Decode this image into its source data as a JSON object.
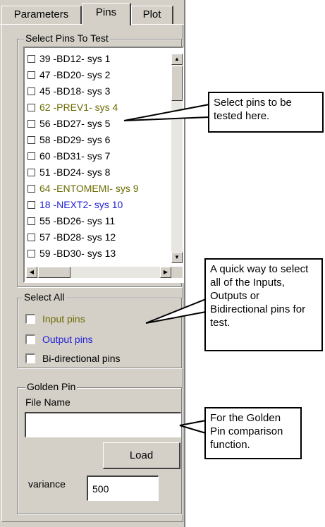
{
  "tabs": [
    {
      "label": "Parameters",
      "active": false
    },
    {
      "label": "Pins",
      "active": true
    },
    {
      "label": "Plot",
      "active": false
    }
  ],
  "select_pins": {
    "title": "Select Pins To Test",
    "items": [
      {
        "label": "39 -BD12- sys 1",
        "color": "#000000"
      },
      {
        "label": "47 -BD20- sys 2",
        "color": "#000000"
      },
      {
        "label": "45 -BD18- sys 3",
        "color": "#000000"
      },
      {
        "label": "62 -PREV1- sys 4",
        "color": "#6b6b00"
      },
      {
        "label": "56 -BD27- sys 5",
        "color": "#000000"
      },
      {
        "label": "58 -BD29- sys 6",
        "color": "#000000"
      },
      {
        "label": "60 -BD31- sys 7",
        "color": "#000000"
      },
      {
        "label": "51 -BD24- sys 8",
        "color": "#000000"
      },
      {
        "label": "64 -ENTOMEMI- sys 9",
        "color": "#6b6b00"
      },
      {
        "label": "18 -NEXT2- sys 10",
        "color": "#1f1fd6"
      },
      {
        "label": "55 -BD26- sys 11",
        "color": "#000000"
      },
      {
        "label": "57 -BD28- sys 12",
        "color": "#000000"
      },
      {
        "label": "59 -BD30- sys 13",
        "color": "#000000"
      }
    ]
  },
  "select_all": {
    "title": "Select All",
    "options": [
      {
        "label": "Input pins",
        "color": "#6b6b00",
        "checked": false
      },
      {
        "label": "Output pins",
        "color": "#1f1fd6",
        "checked": false
      },
      {
        "label": "Bi-directional pins",
        "color": "#000000",
        "checked": false
      }
    ]
  },
  "golden_pin": {
    "title": "Golden Pin",
    "file_name_label": "File Name",
    "file_name_value": "",
    "load_label": "Load",
    "variance_label": "variance",
    "variance_value": "500"
  },
  "callouts": {
    "select_pins": "Select pins to be tested here.",
    "select_all": "A quick way to select all of the Inputs, Outputs or Bidirectional pins for test.",
    "golden_pin": "For the Golden Pin comparison function."
  },
  "icons": {
    "scroll_up": "▲",
    "scroll_down": "▼",
    "scroll_left": "◀",
    "scroll_right": "▶"
  }
}
